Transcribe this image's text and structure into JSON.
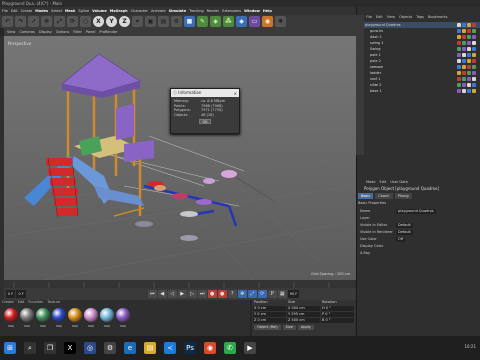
{
  "window": {
    "title": "Playground Qua..(4)C*) - Main"
  },
  "menubar": [
    "File",
    "Edit",
    "Create",
    "Modes",
    "Select",
    "Mesh",
    "Spline",
    "Volume",
    "MoGraph",
    "Character",
    "Animate",
    "Simulate",
    "Tracking",
    "Render",
    "Extensions",
    "Window",
    "Help"
  ],
  "toolbar_letters": {
    "x": "X",
    "y": "Y",
    "z": "Z"
  },
  "viewport": {
    "menu": [
      "View",
      "Cameras",
      "Display",
      "Options",
      "Filter",
      "Panel",
      "ProRender"
    ],
    "label": "Perspective",
    "grid_spacing": "Grid Spacing : 100 cm"
  },
  "dialog": {
    "title": "Information",
    "close": "×",
    "rows": [
      {
        "label": "Memory:",
        "value": "ca. 8.8 MByte"
      },
      {
        "label": "Points:",
        "value": "7968 (7968)"
      },
      {
        "label": "Polygons:",
        "value": "7971 (7730)"
      },
      {
        "label": "Objects:",
        "value": "48 (16)"
      }
    ],
    "ok": "OK"
  },
  "timeline": {
    "start": "0 F",
    "current": "0 F",
    "end": "90 F"
  },
  "materials": {
    "menu": [
      "Create",
      "Edit",
      "Function",
      "Texture"
    ],
    "items": [
      {
        "name": "Mat",
        "color": "#c81f1f"
      },
      {
        "name": "Mat",
        "color": "#7a7a7a"
      },
      {
        "name": "Mat",
        "color": "#3f8f5a"
      },
      {
        "name": "Mat",
        "color": "#2a48c4"
      },
      {
        "name": "Mat",
        "color": "#d68a1a"
      },
      {
        "name": "Mat",
        "color": "#c98ac9"
      },
      {
        "name": "Mat",
        "color": "#6fb3d8"
      },
      {
        "name": "Mat",
        "color": "#8a5ac0"
      }
    ]
  },
  "coordinates": {
    "headers": [
      "Position",
      "Size",
      "Rotation"
    ],
    "rows": [
      [
        "X 0 cm",
        "X 500 cm",
        "H 0 °"
      ],
      [
        "Y 0 cm",
        "Y 295 cm",
        "P 0 °"
      ],
      [
        "Z 0 cm",
        "Z 500 cm",
        "B 0 °"
      ]
    ],
    "mode": "Object (Rel)",
    "size_mode": "Size",
    "apply": "Apply"
  },
  "objects_panel": {
    "menu": [
      "File",
      "Edit",
      "View",
      "Objects",
      "Tags",
      "Bookmarks"
    ],
    "items": [
      {
        "name": "playground Quadros",
        "selected": true
      },
      {
        "name": "gura.ks",
        "selected": false
      },
      {
        "name": "dash 1",
        "selected": false
      },
      {
        "name": "swing 1",
        "selected": false
      },
      {
        "name": "Swing",
        "selected": false
      },
      {
        "name": "pole 1",
        "selected": false
      },
      {
        "name": "pole 2",
        "selected": false
      },
      {
        "name": "seesaw",
        "selected": false
      },
      {
        "name": "ladder",
        "selected": false
      },
      {
        "name": "roof 1",
        "selected": false
      },
      {
        "name": "slide 2",
        "selected": false
      },
      {
        "name": "base 1",
        "selected": false
      }
    ]
  },
  "attributes": {
    "menu": [
      "Mode",
      "Edit",
      "User Data"
    ],
    "title": "Polygon Object [playground Quadros]",
    "tabs": [
      "Basic",
      "Coord.",
      "Phong"
    ],
    "section": "Basic Properties",
    "rows": [
      {
        "label": "Name",
        "value": "playground Quadros"
      },
      {
        "label": "Layer",
        "value": ""
      },
      {
        "label": "Visible in Editor",
        "value": "Default"
      },
      {
        "label": "Visible in Renderer",
        "value": "Default"
      },
      {
        "label": "Use Color",
        "value": "Off"
      },
      {
        "label": "Display Color",
        "value": ""
      },
      {
        "label": "X-Ray",
        "value": ""
      }
    ]
  },
  "taskbar": {
    "time": "10:21",
    "icons": [
      "windows-icon",
      "search-icon",
      "taskview-icon",
      "x-app-icon",
      "cinema4d-icon",
      "gear-icon",
      "edge-icon",
      "files-icon",
      "vscode-icon",
      "photoshop-icon",
      "chrome-icon",
      "whatsapp-icon",
      "media-icon"
    ]
  }
}
